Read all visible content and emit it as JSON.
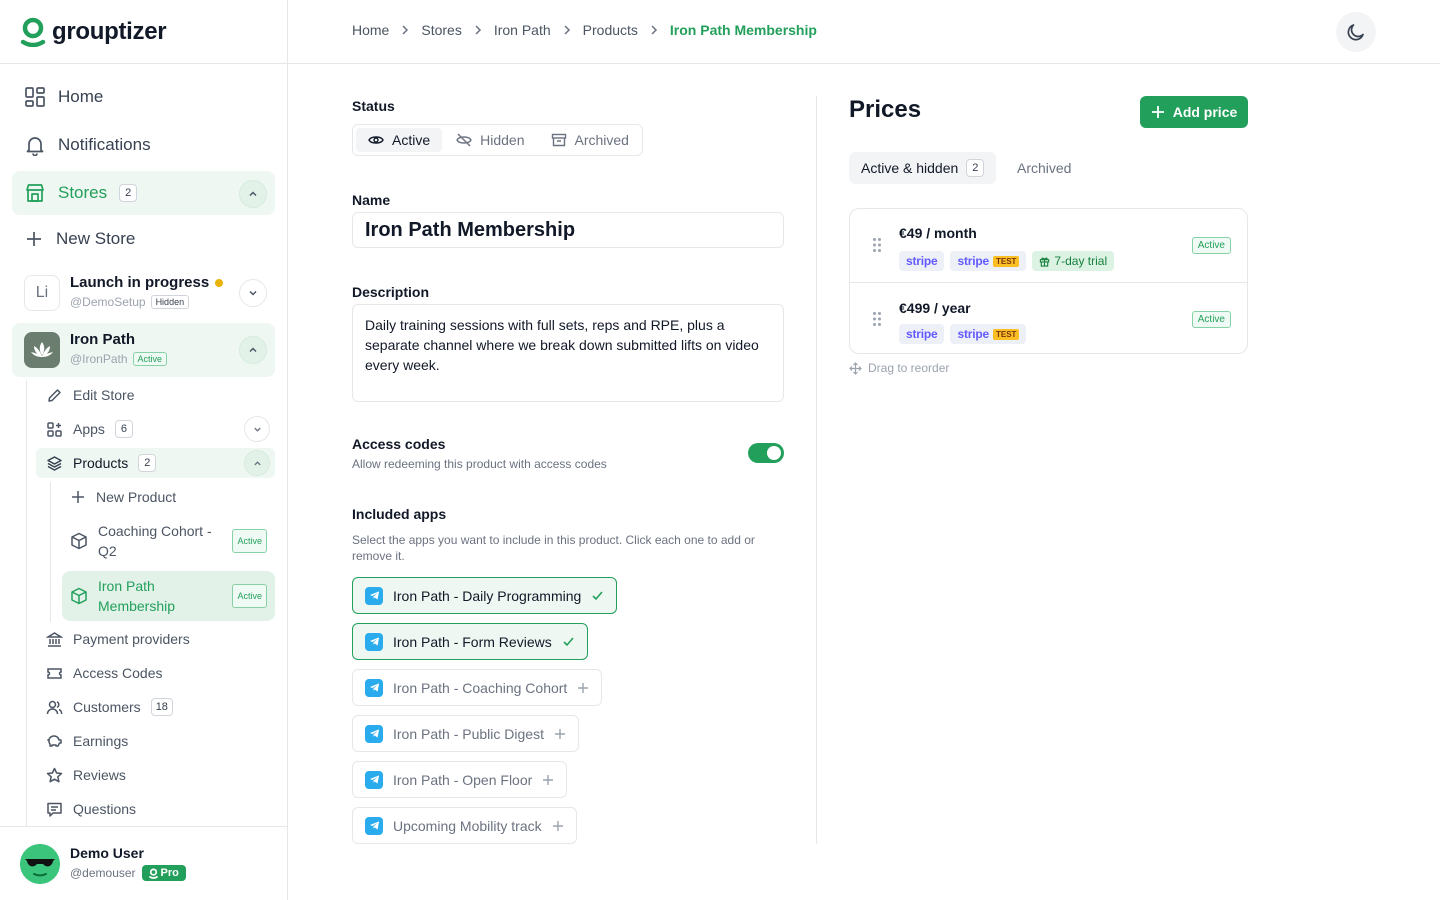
{
  "brand": {
    "name": "grouptizer",
    "accent": "#22a05b"
  },
  "sidebar": {
    "home": "Home",
    "notifications": "Notifications",
    "stores": {
      "label": "Stores",
      "count": "2"
    },
    "new_store": "New Store",
    "store_list": [
      {
        "initials": "Li",
        "name": "Launch in progress",
        "handle": "@DemoSetup",
        "status": "Hidden"
      },
      {
        "name": "Iron Path",
        "handle": "@IronPath",
        "status": "Active"
      }
    ],
    "store_menu": {
      "edit_store": "Edit Store",
      "apps": {
        "label": "Apps",
        "count": "6"
      },
      "products": {
        "label": "Products",
        "count": "2"
      },
      "new_product": "New Product",
      "product_items": [
        {
          "name": "Coaching Cohort - Q2",
          "status": "Active"
        },
        {
          "name": "Iron Path Membership",
          "status": "Active"
        }
      ],
      "payment_providers": "Payment providers",
      "access_codes": "Access Codes",
      "customers": {
        "label": "Customers",
        "count": "18"
      },
      "earnings": "Earnings",
      "reviews": "Reviews",
      "questions": "Questions"
    },
    "user": {
      "name": "Demo User",
      "handle": "@demouser",
      "plan": "Pro"
    }
  },
  "breadcrumb": [
    "Home",
    "Stores",
    "Iron Path",
    "Products",
    "Iron Path Membership"
  ],
  "form": {
    "status_label": "Status",
    "status_options": [
      "Active",
      "Hidden",
      "Archived"
    ],
    "name_label": "Name",
    "name_value": "Iron Path Membership",
    "description_label": "Description",
    "description_value": "Daily training sessions with full sets, reps and RPE, plus a separate channel where we break down submitted lifts on video every week.",
    "access_codes_label": "Access codes",
    "access_codes_help": "Allow redeeming this product with access codes",
    "access_codes_enabled": true,
    "included_apps_label": "Included apps",
    "included_apps_help": "Select the apps you want to include in this product. Click each one to add or remove it.",
    "apps": [
      {
        "name": "Iron Path - Daily Programming",
        "included": true
      },
      {
        "name": "Iron Path - Form Reviews",
        "included": true
      },
      {
        "name": "Iron Path - Coaching Cohort",
        "included": false
      },
      {
        "name": "Iron Path - Public Digest",
        "included": false
      },
      {
        "name": "Iron Path - Open Floor",
        "included": false
      },
      {
        "name": "Upcoming Mobility track",
        "included": false
      }
    ]
  },
  "prices": {
    "title": "Prices",
    "add_label": "Add price",
    "tabs": [
      {
        "label": "Active & hidden",
        "count": "2"
      },
      {
        "label": "Archived"
      }
    ],
    "items": [
      {
        "amount": "€49 / month",
        "provider": "stripe",
        "test_label": "TEST",
        "trial": "7-day trial",
        "status": "Active"
      },
      {
        "amount": "€499 / year",
        "provider": "stripe",
        "test_label": "TEST",
        "status": "Active"
      }
    ],
    "drag_hint": "Drag to reorder"
  }
}
